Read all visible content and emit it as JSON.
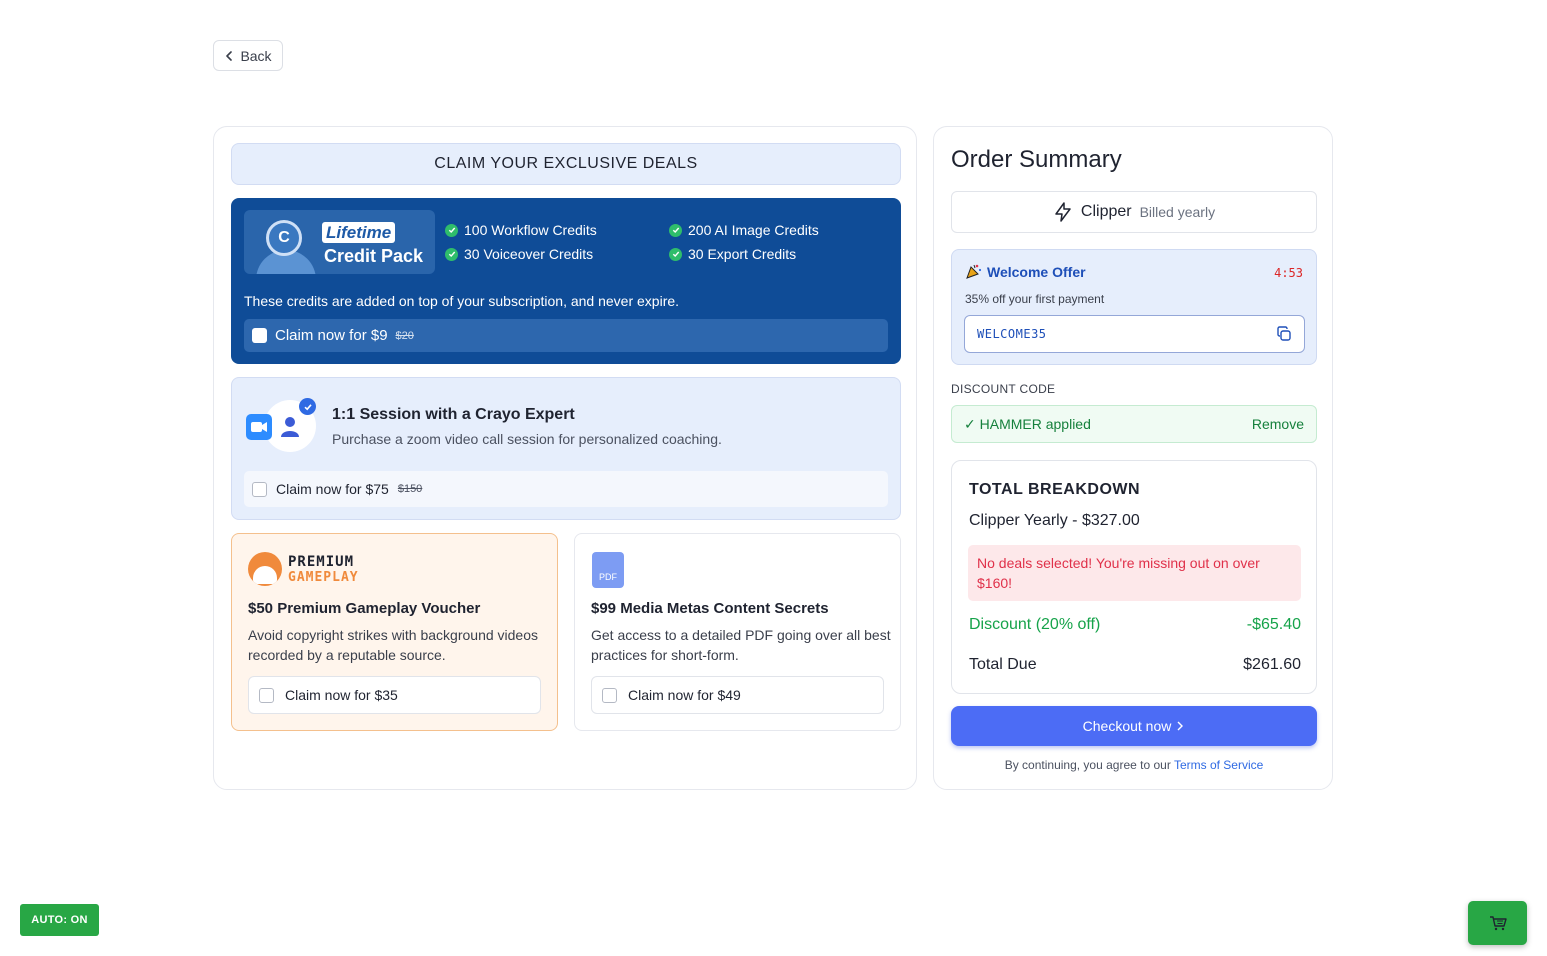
{
  "nav": {
    "back_label": "Back"
  },
  "deals": {
    "header": "CLAIM YOUR EXCLUSIVE DEALS",
    "credit_pack": {
      "badge_top": "Lifetime",
      "badge_bottom": "Credit Pack",
      "badge_letter": "C",
      "items": [
        "100 Workflow Credits",
        "200 AI Image Credits",
        "30 Voiceover Credits",
        "30 Export Credits"
      ],
      "note": "These credits are added on top of your subscription, and never expire.",
      "claim_label": "Claim now for $9",
      "original_price": "$20",
      "checked": false
    },
    "session": {
      "title": "1:1 Session with a Crayo Expert",
      "description": "Purchase a zoom video call session for personalized coaching.",
      "claim_label": "Claim now for $75",
      "original_price": "$150",
      "checked": false
    },
    "voucher": {
      "logo_line1": "PREMIUM",
      "logo_line2": "GAMEPLAY",
      "title": "$50 Premium Gameplay Voucher",
      "description": "Avoid copyright strikes with background videos recorded by a reputable source.",
      "claim_label": "Claim now for $35",
      "checked": false
    },
    "pdf": {
      "icon_text": "PDF",
      "title": "$99 Media Metas Content Secrets",
      "description": "Get access to a detailed PDF going over all best practices for short-form.",
      "claim_label": "Claim now for $49",
      "checked": false
    }
  },
  "summary": {
    "title": "Order Summary",
    "plan_name": "Clipper",
    "plan_billing": "Billed yearly",
    "offer": {
      "title": "Welcome Offer",
      "timer": "4:53",
      "description": "35% off your first payment",
      "code": "WELCOME35"
    },
    "discount_label": "DISCOUNT CODE",
    "applied_text": "✓ HAMMER applied",
    "remove_label": "Remove",
    "breakdown": {
      "title": "TOTAL BREAKDOWN",
      "plan_line": "Clipper Yearly - $327.00",
      "warning": "No deals selected! You're missing out on over $160!",
      "discount_label": "Discount (20% off)",
      "discount_value": "-$65.40",
      "total_label": "Total Due",
      "total_value": "$261.60"
    },
    "checkout_label": "Checkout now",
    "tos_prefix": "By continuing, you agree to our",
    "tos_link": "Terms of Service"
  },
  "auto_badge": "AUTO: ON",
  "colors": {
    "primary_blue": "#0f4c97",
    "accent": "#4c6cf5",
    "success": "#28a745",
    "danger": "#e0314a"
  },
  "icons": [
    "chevron-left-icon",
    "check-circle-icon",
    "zoom-icon",
    "user-icon",
    "verified-badge-icon",
    "pdf-file-icon",
    "lightning-icon",
    "party-popper-icon",
    "copy-icon",
    "chevron-right-icon",
    "cart-icon"
  ]
}
